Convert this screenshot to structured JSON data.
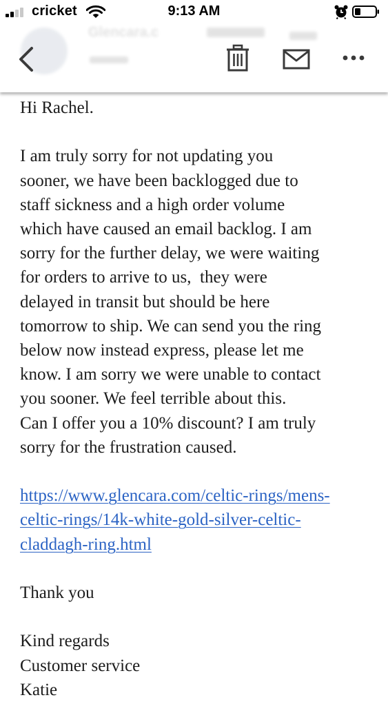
{
  "status_bar": {
    "carrier": "cricket",
    "time": "9:13 AM",
    "signal_bars": 2,
    "signal_bars_total": 4
  },
  "email": {
    "sender_name": "Glencara.c",
    "toolbar": {
      "back_icon": "chevron-left-icon",
      "delete_icon": "trash-icon",
      "mark_unread_icon": "envelope-icon",
      "more_icon": "more-horizontal-icon"
    },
    "body": {
      "greeting": "Hi Rachel.",
      "paragraph_lines": [
        "I am truly sorry for not updating you",
        "sooner, we have been backlogged due to",
        "staff sickness and a high order volume",
        "which have caused an email backlog. I am",
        "sorry for the further delay, we were waiting",
        "for orders to arrive to us,  they were",
        "delayed in transit but should be here",
        "tomorrow to ship. We can send you the ring",
        "below now instead express, please let me",
        "know. I am sorry we were unable to contact",
        "you sooner. We feel terrible about this.",
        "Can I offer you a 10% discount? I am truly",
        "sorry for the frustration caused."
      ],
      "link_lines": [
        "https://www.glencara.com/celtic-rings/mens-",
        "celtic-rings/14k-white-gold-silver-celtic-",
        "claddagh-ring.html"
      ],
      "thanks": "Thank you",
      "signature_lines": [
        "Kind regards",
        "Customer service",
        "Katie"
      ]
    }
  },
  "colors": {
    "link": "#2b63c4",
    "text": "#1c1c1c",
    "icon": "#3a3a3a"
  }
}
